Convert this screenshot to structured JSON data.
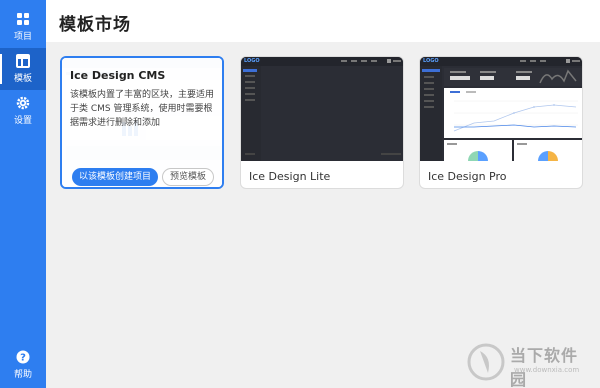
{
  "sidebar": {
    "items": [
      {
        "label": "项目",
        "icon": "grid-icon"
      },
      {
        "label": "模板",
        "icon": "layout-icon"
      },
      {
        "label": "设置",
        "icon": "gear-icon"
      }
    ],
    "help": {
      "label": "帮助",
      "icon": "help-icon"
    }
  },
  "header": {
    "title": "模板市场"
  },
  "templates": [
    {
      "name": "Ice Design CMS",
      "description": "该模板内置了丰富的区块，主要适用于类 CMS 管理系统，使用时需要根据需求进行删除和添加",
      "primary_button": "以该模板创建项目",
      "secondary_button": "预览模板"
    },
    {
      "name": "Ice Design Lite",
      "thumb_logo": "LOGO"
    },
    {
      "name": "Ice Design Pro",
      "thumb_logo": "LOGO"
    }
  ],
  "watermark": {
    "text": "当下软件园",
    "url": "www.downxia.com"
  },
  "colors": {
    "primary": "#2e7ef0",
    "sidebar_active": "#1d63c9",
    "dark_thumb": "#2b2d35"
  }
}
